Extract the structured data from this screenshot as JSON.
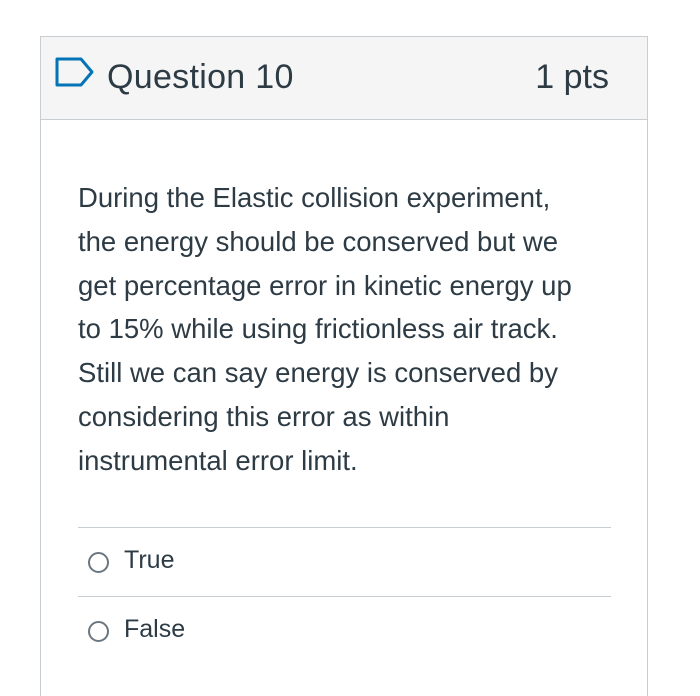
{
  "question": {
    "title": "Question 10",
    "points": "1 pts",
    "text": "During the Elastic collision experiment,\nthe energy should be conserved but  we\nget percentage error in kinetic energy up\nto 15% while using frictionless air track.\nStill we can say energy is conserved by\nconsidering this error as within\ninstrumental error limit.",
    "answers": [
      {
        "label": "True"
      },
      {
        "label": "False"
      }
    ]
  },
  "icons": {
    "flag": "bookmark-flag-icon"
  },
  "colors": {
    "accent": "#0374b5",
    "text": "#2d3b45",
    "border": "#c7cdd1",
    "header_bg": "#f5f5f5"
  }
}
